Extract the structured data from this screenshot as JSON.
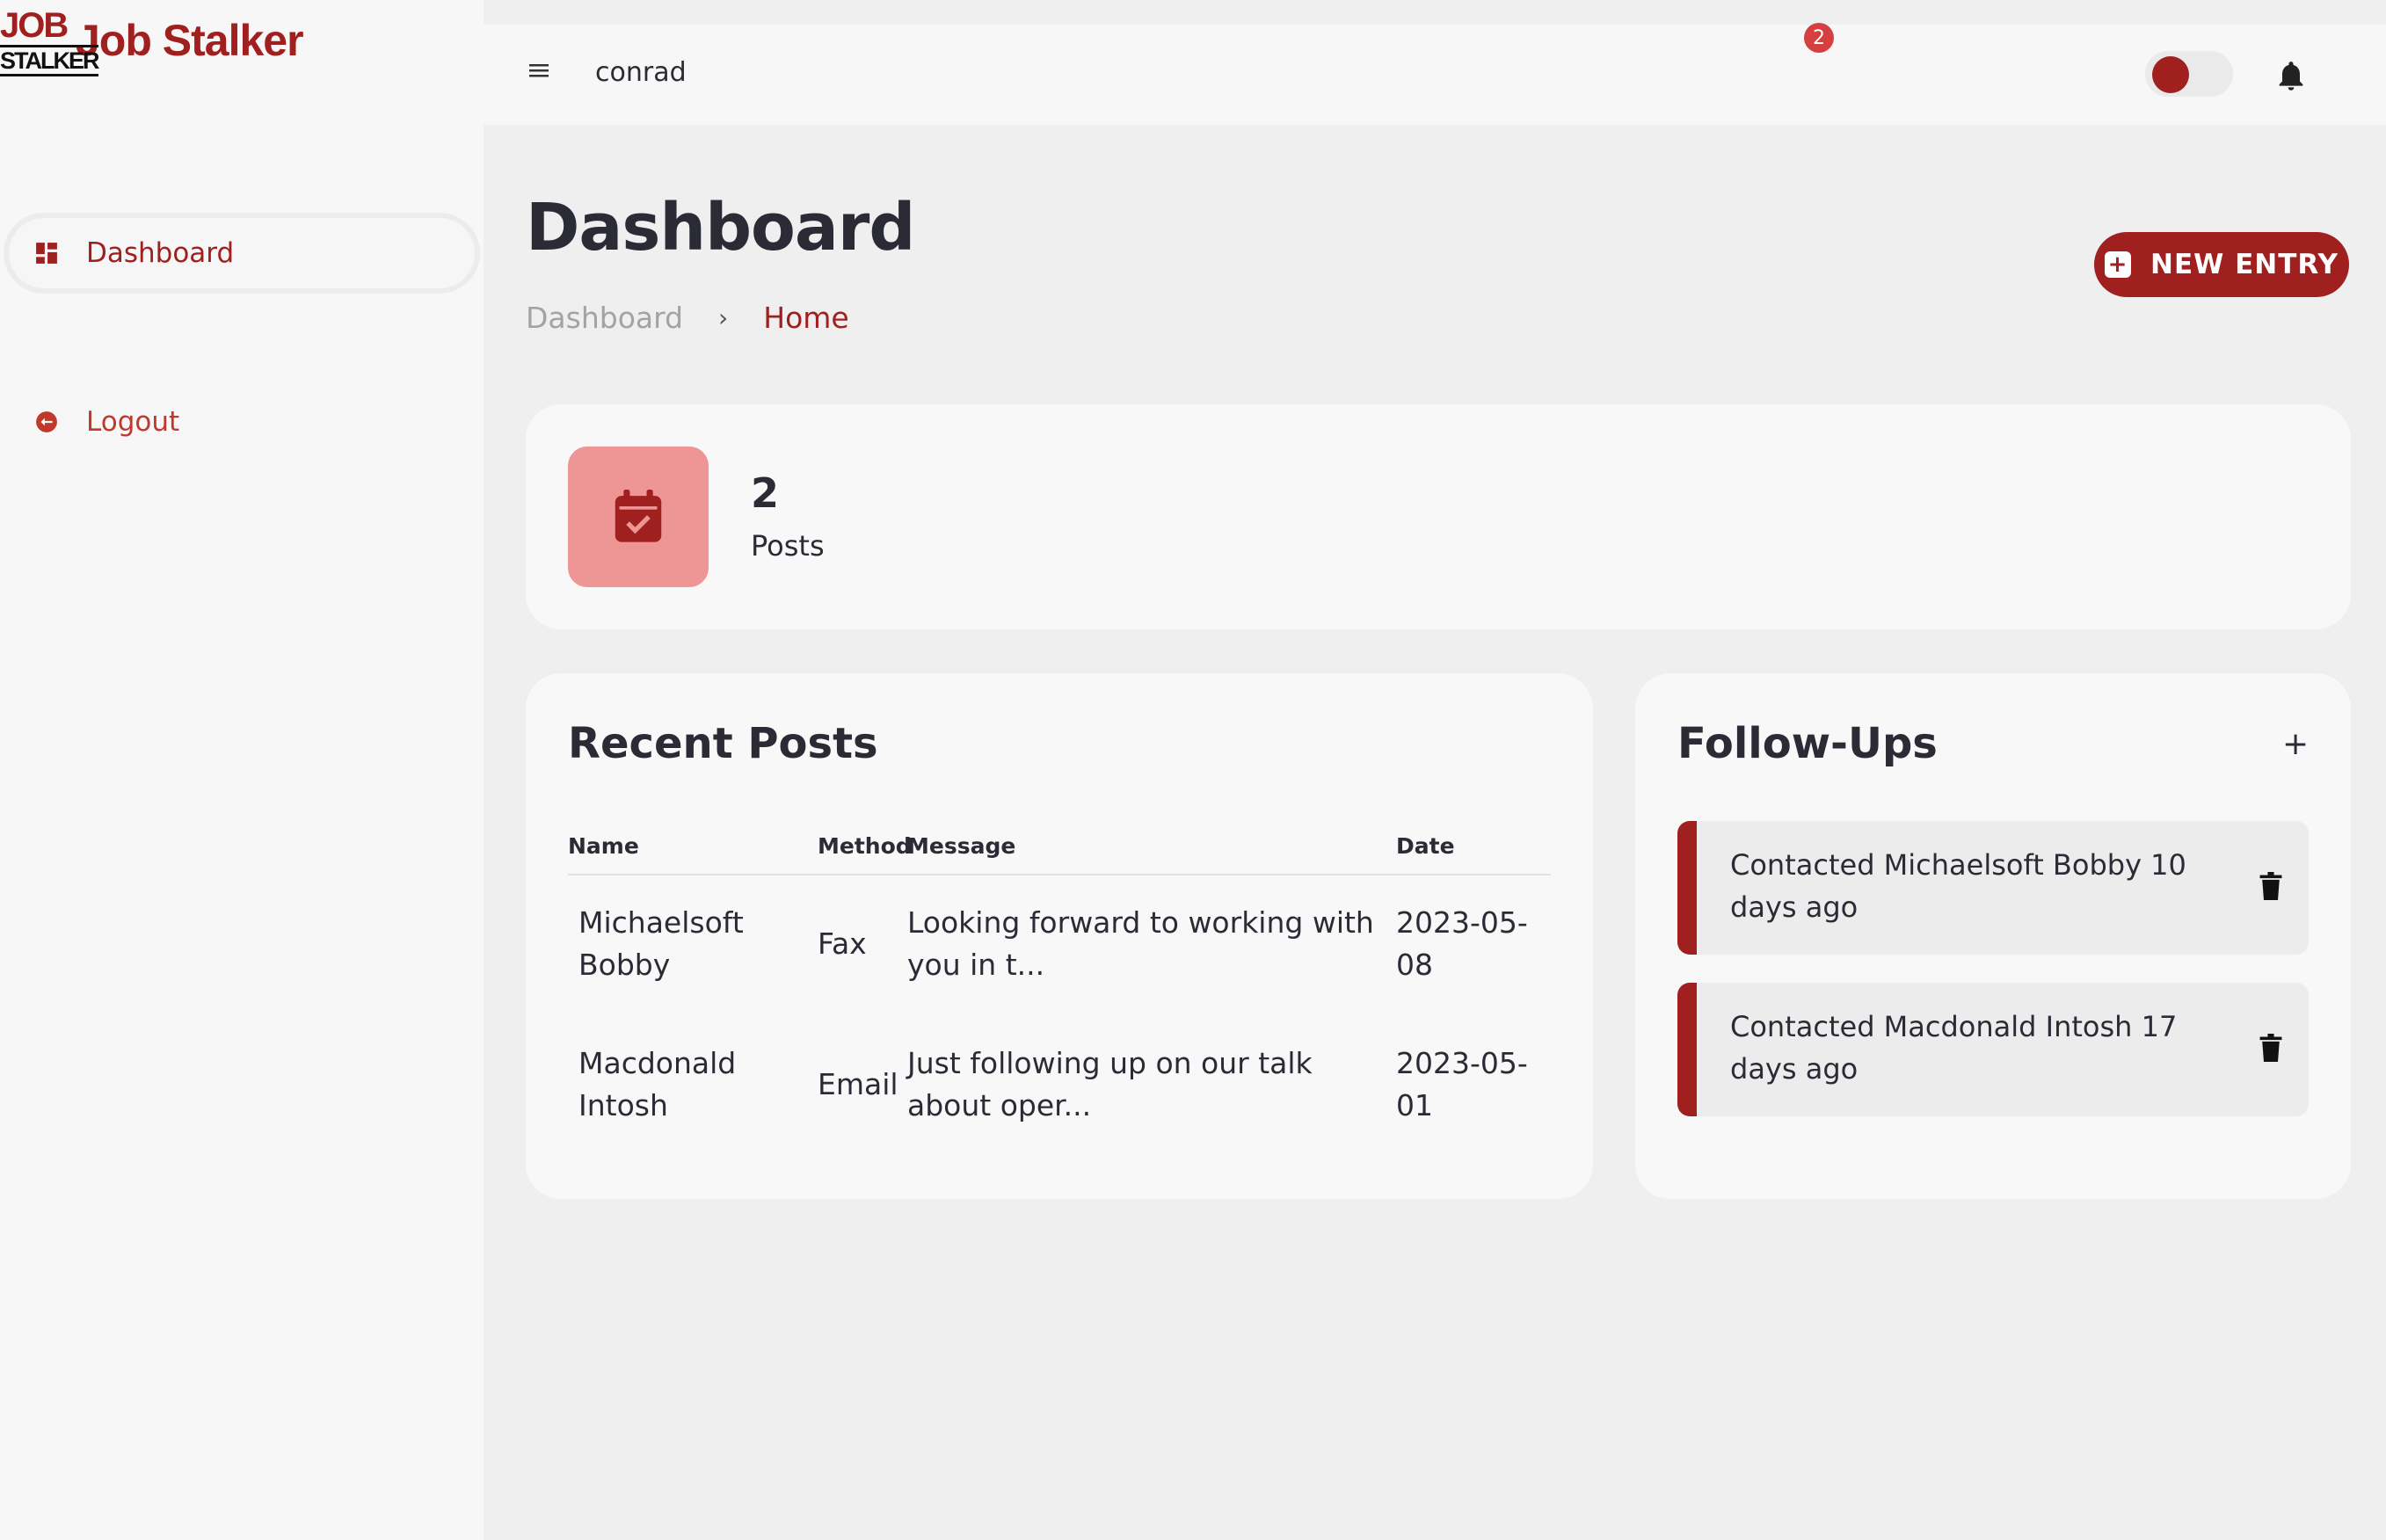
{
  "brand": {
    "logo_top": "JOB",
    "logo_bottom": "STALKER",
    "name": "Job Stalker",
    "color": "#a01f1f"
  },
  "sidebar": {
    "items": [
      {
        "label": "Dashboard",
        "icon": "dashboard-icon",
        "active": true
      },
      {
        "label": "Logout",
        "icon": "logout-icon",
        "active": false
      }
    ]
  },
  "topbar": {
    "menu_icon": "hamburger-icon",
    "username": "conrad",
    "theme_toggle_on": false,
    "notification_count": "2"
  },
  "page": {
    "title": "Dashboard",
    "breadcrumb": [
      "Dashboard",
      "Home"
    ],
    "new_entry_label": "NEW ENTRY"
  },
  "stats": {
    "icon": "calendar-check-icon",
    "value": "2",
    "label": "Posts"
  },
  "recent_posts": {
    "title": "Recent Posts",
    "columns": [
      "Name",
      "Method",
      "Message",
      "Date"
    ],
    "rows": [
      {
        "name": "Michaelsoft Bobby",
        "method": "Fax",
        "message": "Looking forward to working with you in t...",
        "date": "2023-05-08"
      },
      {
        "name": "Macdonald Intosh",
        "method": "Email",
        "message": "Just following up on our talk about oper...",
        "date": "2023-05-01"
      }
    ]
  },
  "followups": {
    "title": "Follow-Ups",
    "add_label": "+",
    "items": [
      {
        "text": "Contacted Michaelsoft Bobby 10 days ago"
      },
      {
        "text": "Contacted Macdonald Intosh 17 days ago"
      }
    ]
  }
}
